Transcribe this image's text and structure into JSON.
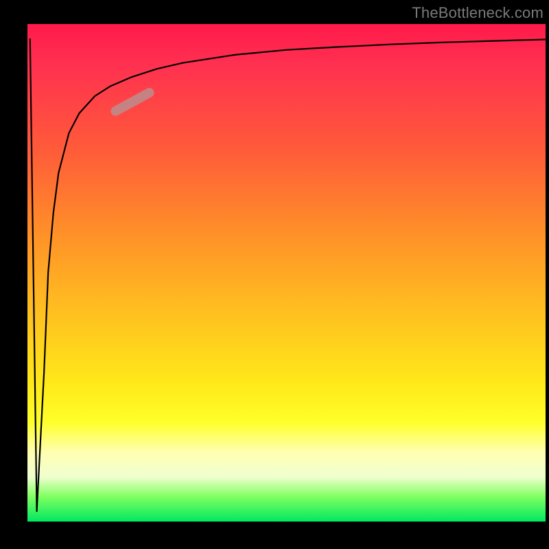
{
  "watermark": "TheBottleneck.com",
  "chart_data": {
    "type": "line",
    "title": "",
    "xlabel": "",
    "ylabel": "",
    "xlim": [
      0,
      100
    ],
    "ylim": [
      0,
      100
    ],
    "grid": false,
    "legend": false,
    "series": [
      {
        "name": "bottleneck-curve",
        "x": [
          0.5,
          1.8,
          3.2,
          4.0,
          5.0,
          6.0,
          8.0,
          10.0,
          13.0,
          16.0,
          20.0,
          25.0,
          30.0,
          40.0,
          50.0,
          60.0,
          70.0,
          80.0,
          90.0,
          100.0
        ],
        "y": [
          97,
          2,
          30,
          50,
          62,
          70,
          78,
          82,
          85.5,
          87.5,
          89.3,
          91.0,
          92.2,
          93.8,
          94.8,
          95.4,
          95.9,
          96.3,
          96.6,
          96.9
        ],
        "color": "#000000"
      },
      {
        "name": "highlight-marker",
        "x": [
          17.0,
          23.5
        ],
        "y": [
          82.5,
          86.2
        ],
        "color": "#c08a88"
      }
    ],
    "annotations": []
  },
  "background_gradient": {
    "top": "#ff1a4a",
    "mid": "#ffe81a",
    "bottom": "#00e860"
  }
}
